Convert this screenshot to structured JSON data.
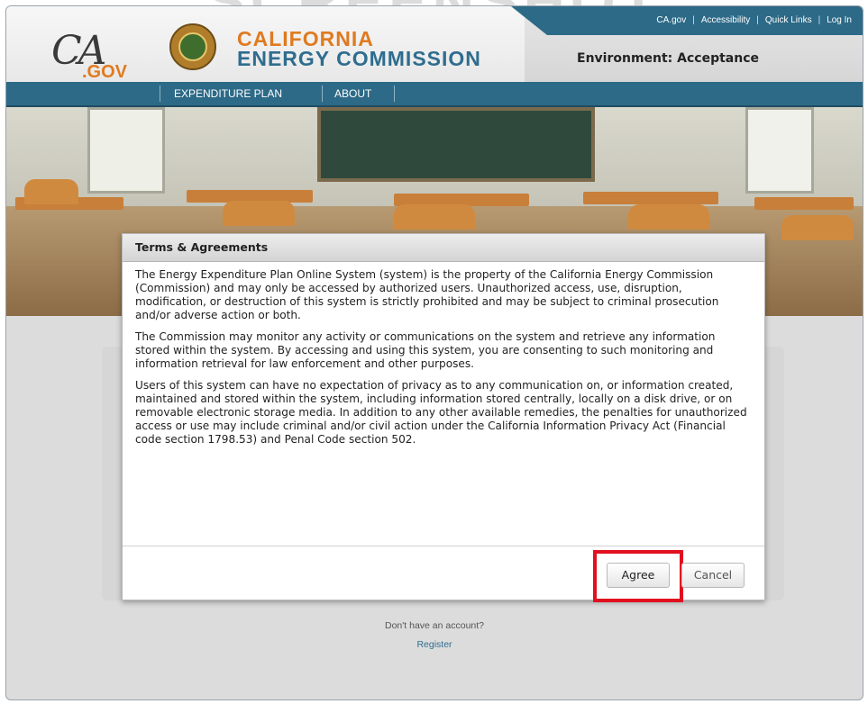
{
  "watermark": "SCREENSHOT",
  "utility_links": [
    "CA.gov",
    "Accessibility",
    "Quick Links",
    "Log In"
  ],
  "utility_separator": "|",
  "environment": "Environment: Acceptance",
  "ca_logo": {
    "script": "CA",
    "gov": ".GOV"
  },
  "brand": {
    "line1": "CALIFORNIA",
    "line2": "ENERGY COMMISSION"
  },
  "nav": [
    "EXPENDITURE PLAN",
    "ABOUT"
  ],
  "dialog": {
    "title": "Terms & Agreements",
    "paragraphs": [
      "The Energy Expenditure Plan Online System (system) is the property of the California Energy Commission (Commission) and may only be accessed by authorized users. Unauthorized access, use, disruption, modification, or destruction of this system is strictly prohibited and may be subject to criminal prosecution and/or adverse action or both.",
      "The Commission may monitor any activity or communications on the system and retrieve any information stored within the system. By accessing and using this system, you are consenting to such monitoring and information retrieval for law enforcement and other purposes.",
      "Users of this system can have no expectation of privacy as to any communication on, or information created, maintained and stored within the system, including information stored centrally, locally on a disk drive, or on removable electronic storage media. In addition to any other available remedies, the penalties for unauthorized access or use may include criminal and/or civil action under the California Information Privacy Act (Financial code section 1798.53) and Penal Code section 502."
    ],
    "agree_label": "Agree",
    "cancel_label": "Cancel"
  },
  "footer": {
    "no_account": "Don't have an account?",
    "register": "Register"
  },
  "colors": {
    "brand_blue": "#2d6a87",
    "brand_orange": "#e07a1f",
    "highlight_red": "#e0101f"
  }
}
